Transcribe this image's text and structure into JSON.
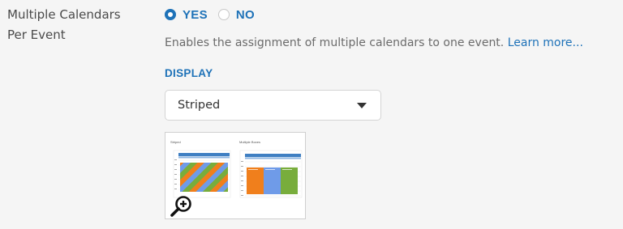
{
  "setting": {
    "label_line1": "Multiple Calendars",
    "label_line2": "Per Event"
  },
  "radio": {
    "options": [
      {
        "label": "YES",
        "checked": true
      },
      {
        "label": "NO",
        "checked": false
      }
    ]
  },
  "help": {
    "text": "Enables the assignment of multiple calendars to one event.",
    "link": "Learn more..."
  },
  "display": {
    "label": "DISPLAY",
    "selected": "Striped"
  },
  "preview": {
    "left_title": "Striped",
    "right_title": "Multiple Boxes",
    "colors": {
      "orange": "#f07f1c",
      "blue": "#6f9be8",
      "green": "#78ad3c",
      "header_blue": "#3f7fc2"
    },
    "icon": "zoom-in-icon"
  },
  "colors": {
    "accent": "#1e72b8",
    "background": "#f5f5f5",
    "label": "#4a4a4a",
    "help": "#6b6b6b"
  }
}
